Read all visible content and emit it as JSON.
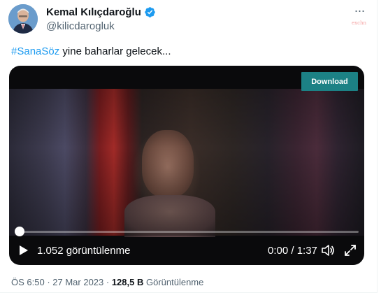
{
  "author": {
    "display_name": "Kemal Kılıçdaroğlu",
    "handle": "@kilicdarogluk",
    "verified_icon": "verified-badge-icon",
    "verified_color": "#1d9bf0"
  },
  "header": {
    "more_label": "···",
    "sponsor_text": "exchn"
  },
  "tweet": {
    "hashtag": "#SanaSöz",
    "text_rest": " yine baharlar gelecek..."
  },
  "video": {
    "download_label": "Download",
    "download_color": "#1c8185",
    "views": "1.052 görüntülenme",
    "time": "0:00 / 1:37",
    "progress": 0,
    "icons": [
      "play-icon",
      "volume-icon",
      "fullscreen-icon"
    ]
  },
  "meta": {
    "time": "ÖS 6:50",
    "sep1": " · ",
    "date": "27 Mar 2023",
    "sep2": " · ",
    "view_count": "128,5 B",
    "view_label": " Görüntülenme"
  },
  "colors": {
    "link": "#1d9bf0",
    "secondary_text": "#536471"
  }
}
